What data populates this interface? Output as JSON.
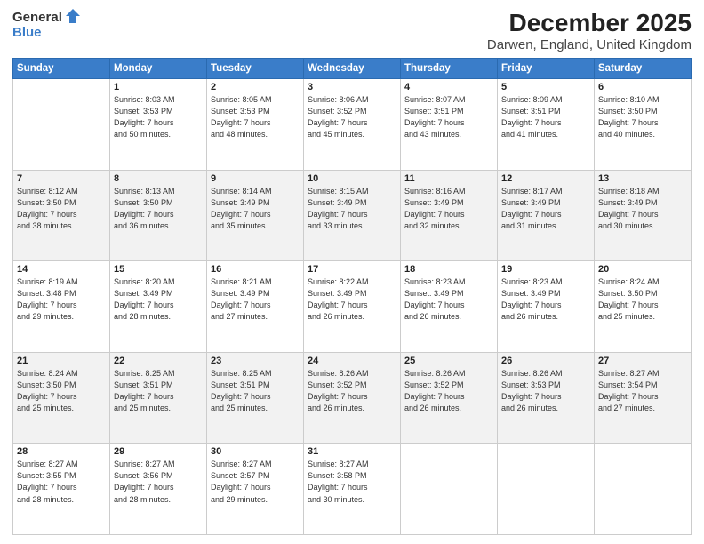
{
  "logo": {
    "general": "General",
    "blue": "Blue"
  },
  "title": "December 2025",
  "subtitle": "Darwen, England, United Kingdom",
  "calendar": {
    "headers": [
      "Sunday",
      "Monday",
      "Tuesday",
      "Wednesday",
      "Thursday",
      "Friday",
      "Saturday"
    ],
    "rows": [
      [
        {
          "day": "",
          "info": ""
        },
        {
          "day": "1",
          "info": "Sunrise: 8:03 AM\nSunset: 3:53 PM\nDaylight: 7 hours\nand 50 minutes."
        },
        {
          "day": "2",
          "info": "Sunrise: 8:05 AM\nSunset: 3:53 PM\nDaylight: 7 hours\nand 48 minutes."
        },
        {
          "day": "3",
          "info": "Sunrise: 8:06 AM\nSunset: 3:52 PM\nDaylight: 7 hours\nand 45 minutes."
        },
        {
          "day": "4",
          "info": "Sunrise: 8:07 AM\nSunset: 3:51 PM\nDaylight: 7 hours\nand 43 minutes."
        },
        {
          "day": "5",
          "info": "Sunrise: 8:09 AM\nSunset: 3:51 PM\nDaylight: 7 hours\nand 41 minutes."
        },
        {
          "day": "6",
          "info": "Sunrise: 8:10 AM\nSunset: 3:50 PM\nDaylight: 7 hours\nand 40 minutes."
        }
      ],
      [
        {
          "day": "7",
          "info": "Sunrise: 8:12 AM\nSunset: 3:50 PM\nDaylight: 7 hours\nand 38 minutes."
        },
        {
          "day": "8",
          "info": "Sunrise: 8:13 AM\nSunset: 3:50 PM\nDaylight: 7 hours\nand 36 minutes."
        },
        {
          "day": "9",
          "info": "Sunrise: 8:14 AM\nSunset: 3:49 PM\nDaylight: 7 hours\nand 35 minutes."
        },
        {
          "day": "10",
          "info": "Sunrise: 8:15 AM\nSunset: 3:49 PM\nDaylight: 7 hours\nand 33 minutes."
        },
        {
          "day": "11",
          "info": "Sunrise: 8:16 AM\nSunset: 3:49 PM\nDaylight: 7 hours\nand 32 minutes."
        },
        {
          "day": "12",
          "info": "Sunrise: 8:17 AM\nSunset: 3:49 PM\nDaylight: 7 hours\nand 31 minutes."
        },
        {
          "day": "13",
          "info": "Sunrise: 8:18 AM\nSunset: 3:49 PM\nDaylight: 7 hours\nand 30 minutes."
        }
      ],
      [
        {
          "day": "14",
          "info": "Sunrise: 8:19 AM\nSunset: 3:48 PM\nDaylight: 7 hours\nand 29 minutes."
        },
        {
          "day": "15",
          "info": "Sunrise: 8:20 AM\nSunset: 3:49 PM\nDaylight: 7 hours\nand 28 minutes."
        },
        {
          "day": "16",
          "info": "Sunrise: 8:21 AM\nSunset: 3:49 PM\nDaylight: 7 hours\nand 27 minutes."
        },
        {
          "day": "17",
          "info": "Sunrise: 8:22 AM\nSunset: 3:49 PM\nDaylight: 7 hours\nand 26 minutes."
        },
        {
          "day": "18",
          "info": "Sunrise: 8:23 AM\nSunset: 3:49 PM\nDaylight: 7 hours\nand 26 minutes."
        },
        {
          "day": "19",
          "info": "Sunrise: 8:23 AM\nSunset: 3:49 PM\nDaylight: 7 hours\nand 26 minutes."
        },
        {
          "day": "20",
          "info": "Sunrise: 8:24 AM\nSunset: 3:50 PM\nDaylight: 7 hours\nand 25 minutes."
        }
      ],
      [
        {
          "day": "21",
          "info": "Sunrise: 8:24 AM\nSunset: 3:50 PM\nDaylight: 7 hours\nand 25 minutes."
        },
        {
          "day": "22",
          "info": "Sunrise: 8:25 AM\nSunset: 3:51 PM\nDaylight: 7 hours\nand 25 minutes."
        },
        {
          "day": "23",
          "info": "Sunrise: 8:25 AM\nSunset: 3:51 PM\nDaylight: 7 hours\nand 25 minutes."
        },
        {
          "day": "24",
          "info": "Sunrise: 8:26 AM\nSunset: 3:52 PM\nDaylight: 7 hours\nand 26 minutes."
        },
        {
          "day": "25",
          "info": "Sunrise: 8:26 AM\nSunset: 3:52 PM\nDaylight: 7 hours\nand 26 minutes."
        },
        {
          "day": "26",
          "info": "Sunrise: 8:26 AM\nSunset: 3:53 PM\nDaylight: 7 hours\nand 26 minutes."
        },
        {
          "day": "27",
          "info": "Sunrise: 8:27 AM\nSunset: 3:54 PM\nDaylight: 7 hours\nand 27 minutes."
        }
      ],
      [
        {
          "day": "28",
          "info": "Sunrise: 8:27 AM\nSunset: 3:55 PM\nDaylight: 7 hours\nand 28 minutes."
        },
        {
          "day": "29",
          "info": "Sunrise: 8:27 AM\nSunset: 3:56 PM\nDaylight: 7 hours\nand 28 minutes."
        },
        {
          "day": "30",
          "info": "Sunrise: 8:27 AM\nSunset: 3:57 PM\nDaylight: 7 hours\nand 29 minutes."
        },
        {
          "day": "31",
          "info": "Sunrise: 8:27 AM\nSunset: 3:58 PM\nDaylight: 7 hours\nand 30 minutes."
        },
        {
          "day": "",
          "info": ""
        },
        {
          "day": "",
          "info": ""
        },
        {
          "day": "",
          "info": ""
        }
      ]
    ]
  }
}
